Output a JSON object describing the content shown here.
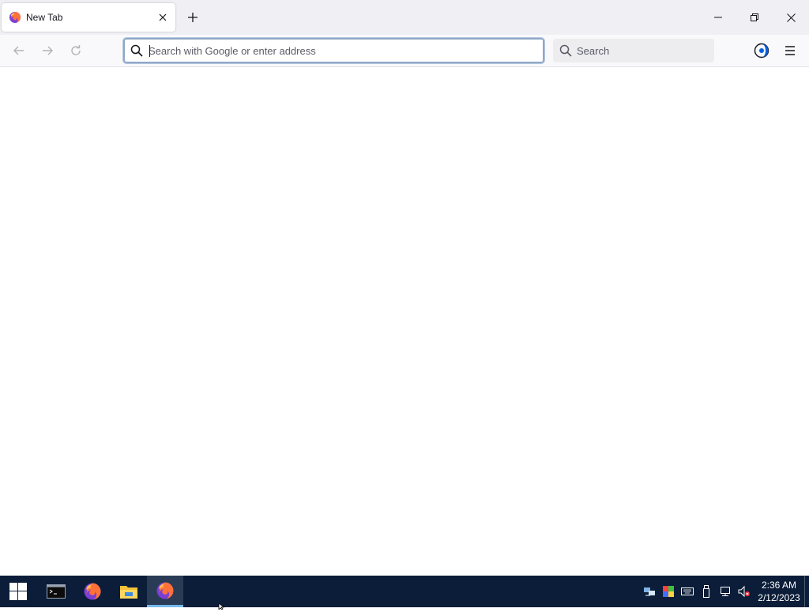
{
  "browser": {
    "tab": {
      "title": "New Tab",
      "favicon": "firefox-icon",
      "close_icon": "close-icon"
    },
    "new_tab_icon": "plus-icon",
    "window_controls": [
      "minimize-icon",
      "restore-icon",
      "close-icon"
    ],
    "nav": {
      "back_icon": "arrow-left-icon",
      "forward_icon": "arrow-right-icon",
      "reload_icon": "reload-icon"
    },
    "urlbar": {
      "placeholder": "Search with Google or enter address",
      "value": "",
      "icon": "search-icon"
    },
    "searchbar": {
      "placeholder": "Search",
      "icon": "search-icon"
    },
    "toolbar_icons": [
      "account-icon",
      "hamburger-menu-icon"
    ]
  },
  "taskbar": {
    "apps": [
      "windows-start-icon",
      "command-prompt-icon",
      "firefox-icon",
      "file-explorer-icon",
      "firefox-icon"
    ],
    "tray_icons": [
      "network-sync-icon",
      "color-icon",
      "keyboard-icon",
      "usb-icon",
      "network-icon",
      "volume-muted-icon"
    ],
    "clock": {
      "time": "2:36 AM",
      "date": "2/12/2023"
    }
  },
  "colors": {
    "accent": "#8fa7c8",
    "taskbar": "#0b1d38",
    "tabstrip": "#f0f0f4"
  }
}
